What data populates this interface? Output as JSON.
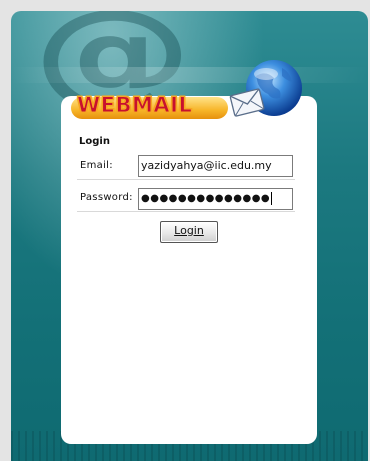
{
  "brand": {
    "logo_text": "WEBMAIL",
    "primary_color": "#c8102e",
    "accent_color": "#f6a623",
    "background_teal": "#137077"
  },
  "form": {
    "heading": "Login",
    "email_label": "Email:",
    "email_value": "yazidyahya@iic.edu.my",
    "password_label": "Password:",
    "password_mask": "●●●●●●●●●●●●●●",
    "submit_label": "Login"
  },
  "icons": {
    "logo": "globe-envelope-icon"
  }
}
